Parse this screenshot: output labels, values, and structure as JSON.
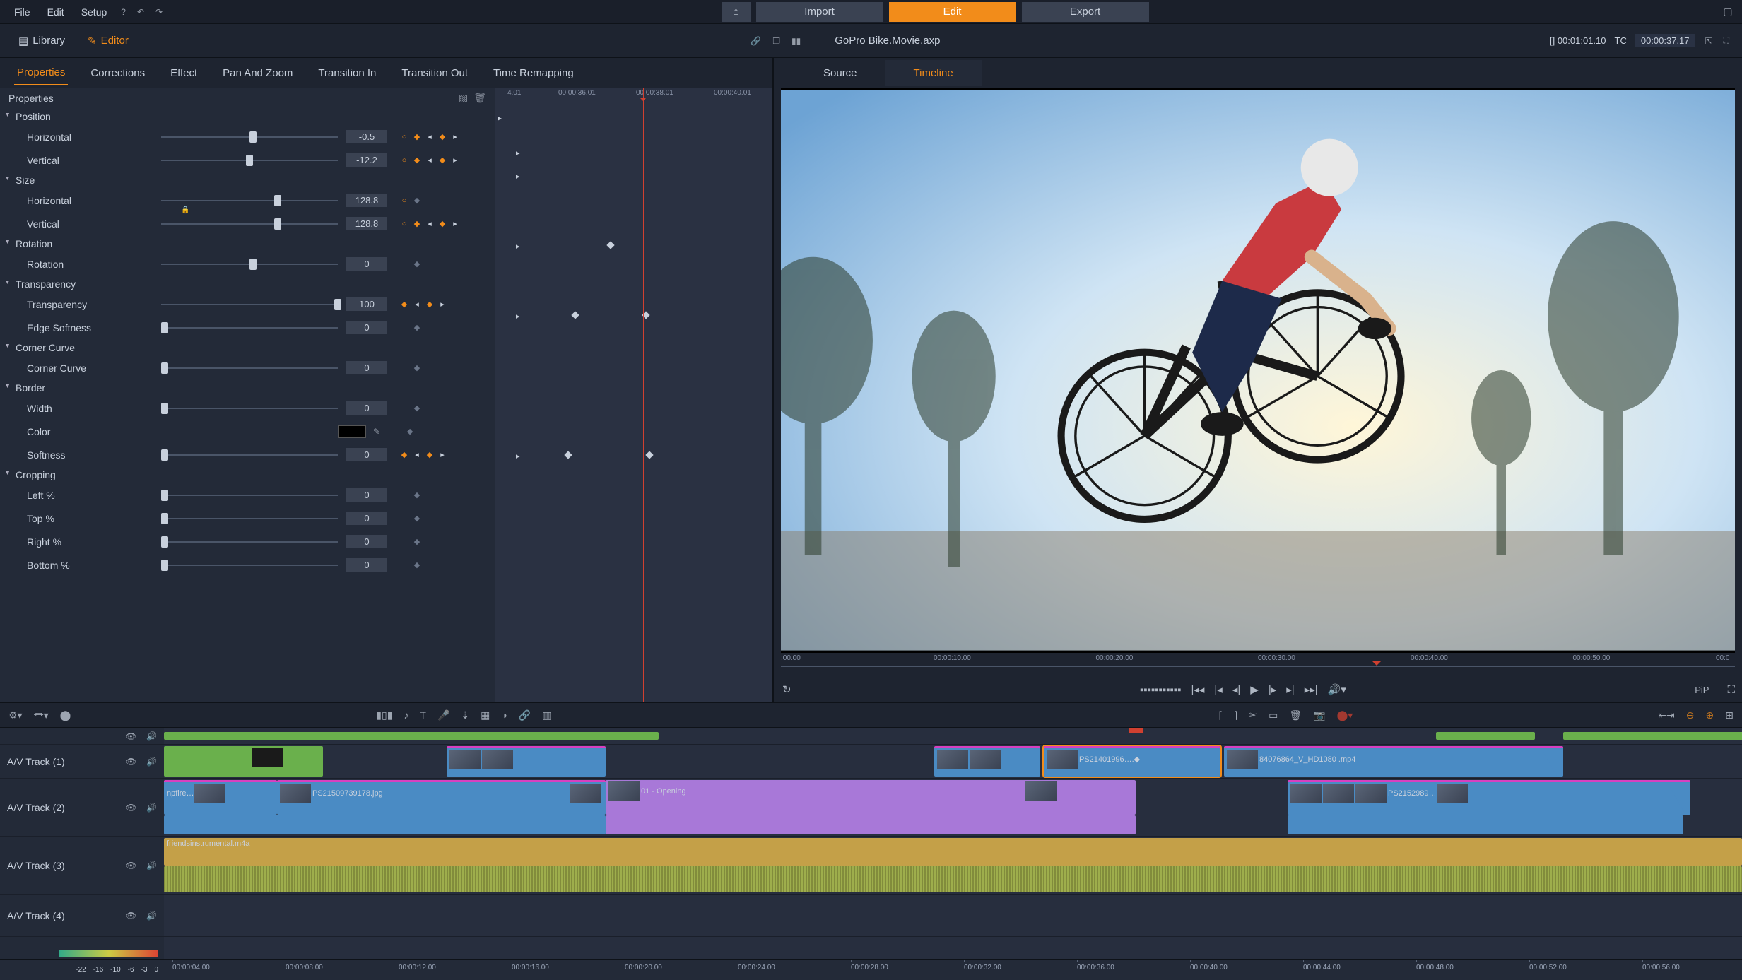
{
  "menu": {
    "file": "File",
    "edit": "Edit",
    "setup": "Setup"
  },
  "modes": {
    "import": "Import",
    "edit": "Edit",
    "export": "Export"
  },
  "libRow": {
    "library": "Library",
    "editor": "Editor",
    "project": "GoPro Bike.Movie.axp",
    "inout": "[]  00:01:01.10",
    "tcLabel": "TC",
    "tc": "00:00:37.17"
  },
  "editTabs": [
    "Properties",
    "Corrections",
    "Effect",
    "Pan And Zoom",
    "Transition In",
    "Transition Out",
    "Time Remapping"
  ],
  "propHeader": "Properties",
  "groups": {
    "position": "Position",
    "size": "Size",
    "rotation": "Rotation",
    "transparency": "Transparency",
    "cornerCurve": "Corner Curve",
    "border": "Border",
    "cropping": "Cropping"
  },
  "props": {
    "posH": {
      "label": "Horizontal",
      "val": "-0.5",
      "thumb": 50
    },
    "posV": {
      "label": "Vertical",
      "val": "-12.2",
      "thumb": 48
    },
    "sizeH": {
      "label": "Horizontal",
      "val": "128.8",
      "thumb": 64
    },
    "sizeV": {
      "label": "Vertical",
      "val": "128.8",
      "thumb": 64
    },
    "rot": {
      "label": "Rotation",
      "val": "0",
      "thumb": 50
    },
    "trans": {
      "label": "Transparency",
      "val": "100",
      "thumb": 100
    },
    "edge": {
      "label": "Edge Softness",
      "val": "0",
      "thumb": 0
    },
    "curve": {
      "label": "Corner Curve",
      "val": "0",
      "thumb": 0
    },
    "bWidth": {
      "label": "Width",
      "val": "0",
      "thumb": 0
    },
    "bColor": {
      "label": "Color"
    },
    "bSoft": {
      "label": "Softness",
      "val": "0",
      "thumb": 0
    },
    "cropL": {
      "label": "Left %",
      "val": "0",
      "thumb": 0
    },
    "cropT": {
      "label": "Top %",
      "val": "0",
      "thumb": 0
    },
    "cropR": {
      "label": "Right %",
      "val": "0",
      "thumb": 0
    },
    "cropB": {
      "label": "Bottom %",
      "val": "0",
      "thumb": 0
    }
  },
  "kfRuler": [
    "4.01",
    "00:00:36.01",
    "00:00:38.01",
    "00:00:40.01"
  ],
  "previewTabs": {
    "source": "Source",
    "timeline": "Timeline"
  },
  "scrubTicks": [
    ":00.00",
    "00:00:10.00",
    "00:00:20.00",
    "00:00:30.00",
    "00:00:40.00",
    "00:00:50.00",
    "00:0"
  ],
  "tracks": {
    "t1": "A/V Track (1)",
    "t2": "A/V Track (2)",
    "t3": "A/V Track (3)",
    "t4": "A/V Track (4)"
  },
  "clips": {
    "c1": "PS21401996….◆",
    "c2": "84076864_V_HD1080 .mp4",
    "c3": "npfire…",
    "c4": "PS21509739178.jpg",
    "c5": "01 - Opening",
    "c6": "PS2152989…",
    "audio": "friendsinstrumental.m4a"
  },
  "meters": [
    "-22",
    "-16",
    "-10",
    "-6",
    "-3",
    "0"
  ],
  "tlRuler": [
    "00:00:04.00",
    "00:00:08.00",
    "00:00:12.00",
    "00:00:16.00",
    "00:00:20.00",
    "00:00:24.00",
    "00:00:28.00",
    "00:00:32.00",
    "00:00:36.00",
    "00:00:40.00",
    "00:00:44.00",
    "00:00:48.00",
    "00:00:52.00",
    "00:00:56.00"
  ],
  "pip": "PiP"
}
